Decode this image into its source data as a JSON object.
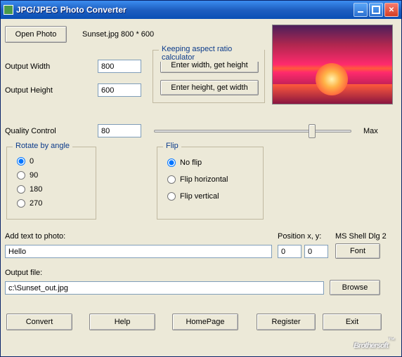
{
  "window": {
    "title": "JPG/JPEG Photo Converter"
  },
  "top": {
    "open_btn": "Open Photo",
    "file_info": "Sunset.jpg 800 * 600"
  },
  "dims": {
    "width_label": "Output Width",
    "width_value": "800",
    "height_label": "Output Height",
    "height_value": "600"
  },
  "aspect": {
    "legend": "Keeping aspect ratio calculator",
    "btn_wh": "Enter width, get height",
    "btn_hw": "Enter height, get width"
  },
  "quality": {
    "label": "Quality Control",
    "value": "80",
    "max_label": "Max"
  },
  "rotate": {
    "legend": "Rotate by angle",
    "opts": {
      "r0": "0",
      "r90": "90",
      "r180": "180",
      "r270": "270"
    },
    "selected": "r0"
  },
  "flip": {
    "legend": "Flip",
    "opts": {
      "none": "No flip",
      "horiz": "Flip horizontal",
      "vert": "Flip vertical"
    },
    "selected": "none"
  },
  "addtext": {
    "label": "Add text to photo:",
    "value": "Hello",
    "pos_label": "Position x, y:",
    "x": "0",
    "y": "0",
    "font_label": "MS Shell Dlg 2",
    "font_btn": "Font"
  },
  "output": {
    "label": "Output file:",
    "value": "c:\\Sunset_out.jpg",
    "browse_btn": "Browse"
  },
  "bottom": {
    "convert": "Convert",
    "help": "Help",
    "homepage": "HomePage",
    "register": "Register",
    "exit": "Exit"
  },
  "watermark": "Brothersoft"
}
